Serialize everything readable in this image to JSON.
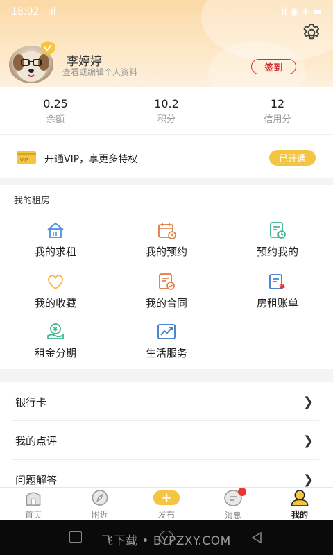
{
  "status_bar": {
    "time": "18:02",
    "signal": ".ııl",
    "right": "ıl ◉ ∗ ▬"
  },
  "profile": {
    "name": "李婷婷",
    "hint": "查看或编辑个人资料",
    "signin_label": "签到"
  },
  "stats": [
    {
      "value": "0.25",
      "label": "余额"
    },
    {
      "value": "10.2",
      "label": "积分"
    },
    {
      "value": "12",
      "label": "信用分"
    }
  ],
  "vip": {
    "icon_text": "VIP",
    "text": "开通VIP，享更多特权",
    "button": "已开通"
  },
  "rental": {
    "title": "我的租房",
    "items": [
      {
        "label": "我的求租",
        "icon": "house-icon"
      },
      {
        "label": "我的预约",
        "icon": "calendar-icon"
      },
      {
        "label": "预约我的",
        "icon": "document-clock-icon"
      },
      {
        "label": "我的收藏",
        "icon": "heart-icon"
      },
      {
        "label": "我的合同",
        "icon": "contract-icon"
      },
      {
        "label": "房租账单",
        "icon": "bill-icon"
      },
      {
        "label": "租金分期",
        "icon": "installment-icon"
      },
      {
        "label": "生活服务",
        "icon": "trend-icon"
      }
    ]
  },
  "list": [
    {
      "label": "银行卡"
    },
    {
      "label": "我的点评"
    },
    {
      "label": "问题解答"
    }
  ],
  "tabs": [
    {
      "label": "首页",
      "icon": "home-icon"
    },
    {
      "label": "附近",
      "icon": "compass-icon"
    },
    {
      "label": "发布",
      "icon": "plus-icon"
    },
    {
      "label": "消息",
      "icon": "message-icon"
    },
    {
      "label": "我的",
      "icon": "user-icon"
    }
  ],
  "watermark": "飞下载 • BYPZXY.COM",
  "colors": {
    "accent": "#f5c542",
    "signin_red": "#d32f2f",
    "header_top": "#fbd9a6"
  }
}
